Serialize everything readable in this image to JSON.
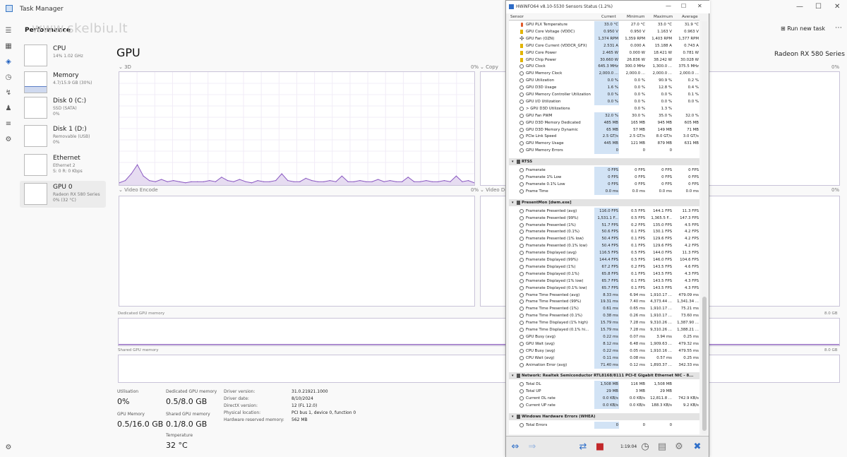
{
  "window": {
    "title": "Task Manager",
    "min": "—",
    "max": "☐",
    "close": "✕"
  },
  "sidebar": {
    "section": "Performance",
    "watermark": "www.skelbiu.lt"
  },
  "devices": [
    {
      "name": "CPU",
      "s1": "14% 1.02 GHz",
      "s2": ""
    },
    {
      "name": "Memory",
      "s1": "4.7/15.9 GB (30%)",
      "s2": ""
    },
    {
      "name": "Disk 0 (C:)",
      "s1": "SSD (SATA)",
      "s2": "0%"
    },
    {
      "name": "Disk 1 (D:)",
      "s1": "Removable (USB)",
      "s2": "0%"
    },
    {
      "name": "Ethernet",
      "s1": "Ethernet 2",
      "s2": "S: 0 R: 0 Kbps"
    },
    {
      "name": "GPU 0",
      "s1": "Radeon RX 580 Series",
      "s2": "0% (32 °C)"
    }
  ],
  "header": {
    "title": "GPU",
    "gpu_name": "Radeon RX 580 Series",
    "run_task": "Run new task"
  },
  "graphs": {
    "g3d": {
      "label": "3D",
      "pct": "0%"
    },
    "copy": {
      "label": "Copy",
      "pct": "0%"
    },
    "venc": {
      "label": "Video Encode",
      "pct": "0%"
    },
    "vdec": {
      "label": "Video De",
      "pct": "0%"
    },
    "ded": {
      "label": "Dedicated GPU memory",
      "max": "8.0 GB"
    },
    "shared": {
      "label": "Shared GPU memory",
      "max": "8.0 GB"
    }
  },
  "stats": {
    "util_label": "Utilisation",
    "util": "0%",
    "ded_label": "Dedicated GPU memory",
    "ded": "0.5/8.0 GB",
    "gpumem_label": "GPU Memory",
    "gpumem": "0.5/16.0 GB",
    "shared_label": "Shared GPU memory",
    "shared": "0.1/8.0 GB",
    "temp_label": "Temperature",
    "temp": "32 °C"
  },
  "info": [
    {
      "k": "Driver version:",
      "v": "31.0.21921.1000"
    },
    {
      "k": "Driver date:",
      "v": "8/10/2024"
    },
    {
      "k": "DirectX version:",
      "v": "12 (FL 12.0)"
    },
    {
      "k": "Physical location:",
      "v": "PCI bus 1, device 0, function 0"
    },
    {
      "k": "Hardware reserved memory:",
      "v": "562 MB"
    }
  ],
  "hwinfo": {
    "title": "HWiNFO64 v8.10-5530 Sensors Status (1.2%)",
    "cols": [
      "Sensor",
      "Current",
      "Minimum",
      "Maximum",
      "Average"
    ],
    "time": "1:19:04",
    "rows": [
      {
        "t": "r",
        "ic": "therm",
        "n": "GPU PLX Temperature",
        "c": "33.0 °C",
        "mi": "27.0 °C",
        "ma": "33.0 °C",
        "av": "31.9 °C"
      },
      {
        "t": "r",
        "ic": "bolt",
        "n": "GPU Core Voltage (VDDC)",
        "c": "0.950 V",
        "mi": "0.950 V",
        "ma": "1.163 V",
        "av": "0.963 V"
      },
      {
        "t": "r",
        "ic": "fan",
        "n": "GPU Fan (OZN)",
        "c": "1,374 RPM",
        "mi": "1,359 RPM",
        "ma": "1,403 RPM",
        "av": "1,377 RPM"
      },
      {
        "t": "r",
        "ic": "bolt",
        "n": "GPU Core Current (VDDCR_GFX)",
        "c": "2.531 A",
        "mi": "0.000 A",
        "ma": "15.188 A",
        "av": "0.743 A"
      },
      {
        "t": "r",
        "ic": "bolt",
        "n": "GPU Core Power",
        "c": "2.465 W",
        "mi": "0.000 W",
        "ma": "18.421 W",
        "av": "0.781 W"
      },
      {
        "t": "r",
        "ic": "bolt",
        "n": "GPU Chip Power",
        "c": "30.660 W",
        "mi": "26.836 W",
        "ma": "38.242 W",
        "av": "30.028 W"
      },
      {
        "t": "r",
        "ic": "",
        "n": "GPU Clock",
        "c": "645.3 MHz",
        "mi": "300.0 MHz",
        "ma": "1,300.0 ...",
        "av": "375.5 MHz"
      },
      {
        "t": "r",
        "ic": "",
        "n": "GPU Memory Clock",
        "c": "2,000.0 ...",
        "mi": "2,000.0 ...",
        "ma": "2,000.0 ...",
        "av": "2,000.0 ..."
      },
      {
        "t": "r",
        "ic": "",
        "n": "GPU Utilization",
        "c": "0.0 %",
        "mi": "0.0 %",
        "ma": "90.9 %",
        "av": "0.2 %"
      },
      {
        "t": "r",
        "ic": "",
        "n": "GPU D3D Usage",
        "c": "1.6 %",
        "mi": "0.0 %",
        "ma": "12.8 %",
        "av": "0.4 %"
      },
      {
        "t": "r",
        "ic": "",
        "n": "GPU Memory Controller Utilization",
        "c": "0.0 %",
        "mi": "0.0 %",
        "ma": "0.0 %",
        "av": "0.1 %"
      },
      {
        "t": "r",
        "ic": "",
        "n": "GPU I/O Utilization",
        "c": "0.0 %",
        "mi": "0.0 %",
        "ma": "0.0 %",
        "av": "0.0 %"
      },
      {
        "t": "r",
        "ic": "",
        "n": "> GPU D3D Utilizations",
        "c": "",
        "mi": "0.0 %",
        "ma": "1.3 %",
        "av": ""
      },
      {
        "t": "r",
        "ic": "",
        "n": "GPU Fan PWM",
        "c": "32.0 %",
        "mi": "30.0 %",
        "ma": "35.0 %",
        "av": "32.0 %"
      },
      {
        "t": "r",
        "ic": "",
        "n": "GPU D3D Memory Dedicated",
        "c": "485 MB",
        "mi": "165 MB",
        "ma": "945 MB",
        "av": "605 MB"
      },
      {
        "t": "r",
        "ic": "",
        "n": "GPU D3D Memory Dynamic",
        "c": "65 MB",
        "mi": "57 MB",
        "ma": "149 MB",
        "av": "71 MB"
      },
      {
        "t": "r",
        "ic": "",
        "n": "PCIe Link Speed",
        "c": "2.5 GT/s",
        "mi": "2.5 GT/s",
        "ma": "8.0 GT/s",
        "av": "3.0 GT/s"
      },
      {
        "t": "r",
        "ic": "",
        "n": "GPU Memory Usage",
        "c": "445 MB",
        "mi": "121 MB",
        "ma": "879 MB",
        "av": "631 MB"
      },
      {
        "t": "r",
        "ic": "",
        "n": "GPU Memory Errors",
        "c": "0",
        "mi": "0",
        "ma": "0",
        "av": ""
      },
      {
        "t": "gap"
      },
      {
        "t": "g",
        "n": "RTSS"
      },
      {
        "t": "r",
        "ic": "",
        "n": "Framerate",
        "c": "0 FPS",
        "mi": "0 FPS",
        "ma": "0 FPS",
        "av": "0 FPS"
      },
      {
        "t": "r",
        "ic": "",
        "n": "Framerate 1% Low",
        "c": "0 FPS",
        "mi": "0 FPS",
        "ma": "0 FPS",
        "av": "0 FPS"
      },
      {
        "t": "r",
        "ic": "",
        "n": "Framerate 0.1% Low",
        "c": "0 FPS",
        "mi": "0 FPS",
        "ma": "0 FPS",
        "av": "0 FPS"
      },
      {
        "t": "r",
        "ic": "",
        "n": "Frame Time",
        "c": "0.0 ms",
        "mi": "0.0 ms",
        "ma": "0.0 ms",
        "av": "0.0 ms"
      },
      {
        "t": "gap"
      },
      {
        "t": "g",
        "n": "PresentMon [dwm.exe]"
      },
      {
        "t": "r",
        "ic": "",
        "n": "Framerate Presented (avg)",
        "c": "116.0 FPS",
        "mi": "0.5 FPS",
        "ma": "144.1 FPS",
        "av": "11.3 FPS"
      },
      {
        "t": "r",
        "ic": "",
        "n": "Framerate Presented (99%)",
        "c": "1,531.1 F...",
        "mi": "0.5 FPS",
        "ma": "1,365.5 F...",
        "av": "147.3 FPS"
      },
      {
        "t": "r",
        "ic": "",
        "n": "Framerate Presented (1%)",
        "c": "51.7 FPS",
        "mi": "0.2 FPS",
        "ma": "135.0 FPS",
        "av": "4.5 FPS"
      },
      {
        "t": "r",
        "ic": "",
        "n": "Framerate Presented (0.1%)",
        "c": "50.6 FPS",
        "mi": "0.1 FPS",
        "ma": "130.1 FPS",
        "av": "4.2 FPS"
      },
      {
        "t": "r",
        "ic": "",
        "n": "Framerate Presented (1% low)",
        "c": "50.4 FPS",
        "mi": "0.1 FPS",
        "ma": "129.6 FPS",
        "av": "4.2 FPS"
      },
      {
        "t": "r",
        "ic": "",
        "n": "Framerate Presented (0.1% low)",
        "c": "50.4 FPS",
        "mi": "0.1 FPS",
        "ma": "129.6 FPS",
        "av": "4.2 FPS"
      },
      {
        "t": "r",
        "ic": "",
        "n": "Framerate Displayed (avg)",
        "c": "116.5 FPS",
        "mi": "0.5 FPS",
        "ma": "144.0 FPS",
        "av": "11.3 FPS"
      },
      {
        "t": "r",
        "ic": "",
        "n": "Framerate Displayed (99%)",
        "c": "144.4 FPS",
        "mi": "0.5 FPS",
        "ma": "146.0 FPS",
        "av": "104.6 FPS"
      },
      {
        "t": "r",
        "ic": "",
        "n": "Framerate Displayed (1%)",
        "c": "67.2 FPS",
        "mi": "0.2 FPS",
        "ma": "143.5 FPS",
        "av": "4.6 FPS"
      },
      {
        "t": "r",
        "ic": "",
        "n": "Framerate Displayed (0.1%)",
        "c": "65.8 FPS",
        "mi": "0.1 FPS",
        "ma": "143.5 FPS",
        "av": "4.3 FPS"
      },
      {
        "t": "r",
        "ic": "",
        "n": "Framerate Displayed (1% low)",
        "c": "65.7 FPS",
        "mi": "0.1 FPS",
        "ma": "143.5 FPS",
        "av": "4.3 FPS"
      },
      {
        "t": "r",
        "ic": "",
        "n": "Framerate Displayed (0.1% low)",
        "c": "65.7 FPS",
        "mi": "0.1 FPS",
        "ma": "143.5 FPS",
        "av": "4.3 FPS"
      },
      {
        "t": "r",
        "ic": "",
        "n": "Frame Time Presented (avg)",
        "c": "8.33 ms",
        "mi": "6.94 ms",
        "ma": "1,910.17 ...",
        "av": "479.09 ms"
      },
      {
        "t": "r",
        "ic": "",
        "n": "Frame Time Presented (99%)",
        "c": "19.31 ms",
        "mi": "7.40 ms",
        "ma": "4,373.44 ...",
        "av": "1,341.34 ..."
      },
      {
        "t": "r",
        "ic": "",
        "n": "Frame Time Presented (1%)",
        "c": "0.61 ms",
        "mi": "0.65 ms",
        "ma": "1,910.17 ...",
        "av": "75.21 ms"
      },
      {
        "t": "r",
        "ic": "",
        "n": "Frame Time Presented (0.1%)",
        "c": "0.38 ms",
        "mi": "0.26 ms",
        "ma": "1,910.17 ...",
        "av": "73.60 ms"
      },
      {
        "t": "r",
        "ic": "",
        "n": "Frame Time Displayed (1% high)",
        "c": "15.79 ms",
        "mi": "7.28 ms",
        "ma": "9,310.26 ...",
        "av": "1,387.90 ..."
      },
      {
        "t": "r",
        "ic": "",
        "n": "Frame Time Displayed (0.1% hi...",
        "c": "15.79 ms",
        "mi": "7.28 ms",
        "ma": "9,310.26 ...",
        "av": "1,388.21 ..."
      },
      {
        "t": "r",
        "ic": "",
        "n": "GPU Busy (avg)",
        "c": "0.22 ms",
        "mi": "0.07 ms",
        "ma": "3.94 ms",
        "av": "0.25 ms"
      },
      {
        "t": "r",
        "ic": "",
        "n": "GPU Wait (avg)",
        "c": "8.12 ms",
        "mi": "6.48 ms",
        "ma": "1,909.63 ...",
        "av": "479.32 ms"
      },
      {
        "t": "r",
        "ic": "",
        "n": "CPU Busy (avg)",
        "c": "0.22 ms",
        "mi": "0.05 ms",
        "ma": "1,910.16 ...",
        "av": "479.55 ms"
      },
      {
        "t": "r",
        "ic": "",
        "n": "CPU Wait (avg)",
        "c": "0.11 ms",
        "mi": "0.08 ms",
        "ma": "0.57 ms",
        "av": "0.25 ms"
      },
      {
        "t": "r",
        "ic": "",
        "n": "Animation Error (avg)",
        "c": "71.40 ms",
        "mi": "0.12 ms",
        "ma": "1,893.37 ...",
        "av": "342.33 ms"
      },
      {
        "t": "gap"
      },
      {
        "t": "g",
        "n": "Network: Realtek Semiconductor RTL8168/8111 PCI-E Gigabit Ethernet NIC - 8..."
      },
      {
        "t": "r",
        "ic": "",
        "n": "Total DL",
        "c": "1,508 MB",
        "mi": "116 MB",
        "ma": "1,508 MB",
        "av": ""
      },
      {
        "t": "r",
        "ic": "",
        "n": "Total UP",
        "c": "29 MB",
        "mi": "3 MB",
        "ma": "29 MB",
        "av": ""
      },
      {
        "t": "r",
        "ic": "",
        "n": "Current DL rate",
        "c": "0.0 KB/s",
        "mi": "0.0 KB/s",
        "ma": "12,811.8 ...",
        "av": "742.9 KB/s"
      },
      {
        "t": "r",
        "ic": "",
        "n": "Current UP rate",
        "c": "0.0 KB/s",
        "mi": "0.0 KB/s",
        "ma": "188.3 KB/s",
        "av": "9.2 KB/s"
      },
      {
        "t": "gap"
      },
      {
        "t": "g",
        "n": "Windows Hardware Errors (WHEA)"
      },
      {
        "t": "r",
        "ic": "",
        "n": "Total Errors",
        "c": "0",
        "mi": "0",
        "ma": "0",
        "av": ""
      }
    ]
  },
  "chart_data": {
    "type": "area",
    "title": "3D",
    "x": [
      0,
      1,
      2,
      3,
      4,
      5,
      6,
      7,
      8,
      9,
      10,
      11,
      12,
      13,
      14,
      15,
      16,
      17,
      18,
      19,
      20,
      21,
      22,
      23,
      24,
      25,
      26,
      27,
      28,
      29,
      30,
      31,
      32,
      33,
      34,
      35,
      36,
      37,
      38,
      39,
      40,
      41,
      42,
      43,
      44,
      45,
      46,
      47,
      48,
      49,
      50,
      51,
      52,
      53,
      54,
      55,
      56,
      57,
      58,
      59
    ],
    "series": [
      {
        "values": [
          2,
          4,
          10,
          18,
          8,
          4,
          3,
          5,
          3,
          4,
          3,
          2,
          3,
          3,
          3,
          4,
          3,
          7,
          4,
          3,
          5,
          3,
          2,
          4,
          3,
          3,
          4,
          10,
          4,
          3,
          3,
          6,
          4,
          3,
          3,
          4,
          3,
          8,
          3,
          3,
          4,
          3,
          3,
          5,
          3,
          4,
          3,
          3,
          7,
          3,
          3,
          4,
          3,
          3,
          4,
          3,
          8,
          3,
          4,
          2
        ]
      }
    ],
    "ylim": [
      0,
      100
    ]
  }
}
